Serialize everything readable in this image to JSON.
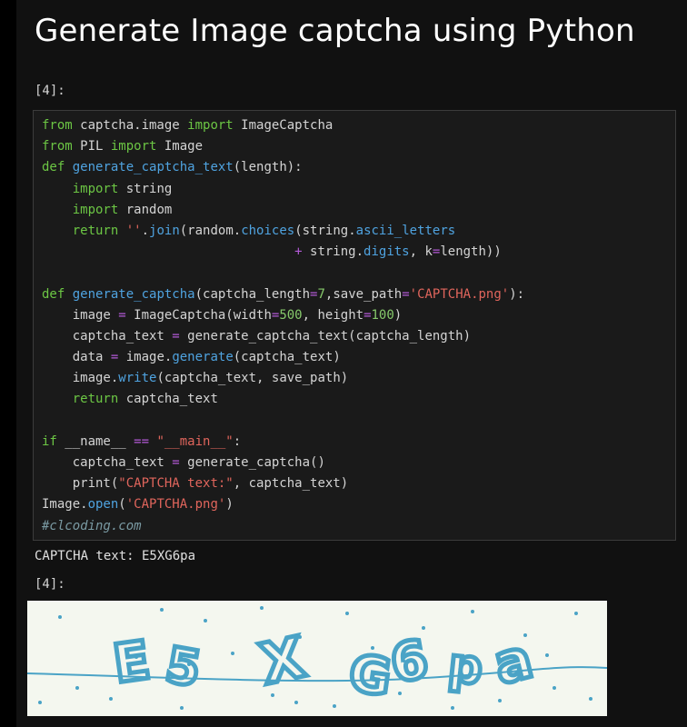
{
  "page": {
    "title": "Generate Image captcha using Python"
  },
  "input_cell": {
    "prompt": "[4]:",
    "lines": [
      [
        {
          "t": "from",
          "c": "kw"
        },
        {
          "t": " captcha.image ",
          "c": "tx"
        },
        {
          "t": "import",
          "c": "kw"
        },
        {
          "t": " ImageCaptcha",
          "c": "tx"
        }
      ],
      [
        {
          "t": "from",
          "c": "kw"
        },
        {
          "t": " PIL ",
          "c": "tx"
        },
        {
          "t": "import",
          "c": "kw"
        },
        {
          "t": " Image",
          "c": "tx"
        }
      ],
      [
        {
          "t": "def",
          "c": "kw"
        },
        {
          "t": " ",
          "c": "tx"
        },
        {
          "t": "generate_captcha_text",
          "c": "fn"
        },
        {
          "t": "(length):",
          "c": "tx"
        }
      ],
      [
        {
          "t": "    ",
          "c": "tx"
        },
        {
          "t": "import",
          "c": "kw"
        },
        {
          "t": " string",
          "c": "tx"
        }
      ],
      [
        {
          "t": "    ",
          "c": "tx"
        },
        {
          "t": "import",
          "c": "kw"
        },
        {
          "t": " random",
          "c": "tx"
        }
      ],
      [
        {
          "t": "    ",
          "c": "tx"
        },
        {
          "t": "return",
          "c": "kw"
        },
        {
          "t": " ",
          "c": "tx"
        },
        {
          "t": "''",
          "c": "str"
        },
        {
          "t": ".",
          "c": "tx"
        },
        {
          "t": "join",
          "c": "fn"
        },
        {
          "t": "(random.",
          "c": "tx"
        },
        {
          "t": "choices",
          "c": "fn"
        },
        {
          "t": "(string.",
          "c": "tx"
        },
        {
          "t": "ascii_letters",
          "c": "fn"
        }
      ],
      [
        {
          "t": "                                 ",
          "c": "tx"
        },
        {
          "t": "+",
          "c": "op"
        },
        {
          "t": " string.",
          "c": "tx"
        },
        {
          "t": "digits",
          "c": "fn"
        },
        {
          "t": ", k",
          "c": "tx"
        },
        {
          "t": "=",
          "c": "op"
        },
        {
          "t": "length))",
          "c": "tx"
        }
      ],
      [],
      [
        {
          "t": "def",
          "c": "kw"
        },
        {
          "t": " ",
          "c": "tx"
        },
        {
          "t": "generate_captcha",
          "c": "fn"
        },
        {
          "t": "(captcha_length",
          "c": "tx"
        },
        {
          "t": "=",
          "c": "op"
        },
        {
          "t": "7",
          "c": "num"
        },
        {
          "t": ",save_path",
          "c": "tx"
        },
        {
          "t": "=",
          "c": "op"
        },
        {
          "t": "'CAPTCHA.png'",
          "c": "str"
        },
        {
          "t": "):",
          "c": "tx"
        }
      ],
      [
        {
          "t": "    image ",
          "c": "tx"
        },
        {
          "t": "=",
          "c": "op"
        },
        {
          "t": " ImageCaptcha(width",
          "c": "tx"
        },
        {
          "t": "=",
          "c": "op"
        },
        {
          "t": "500",
          "c": "num"
        },
        {
          "t": ", height",
          "c": "tx"
        },
        {
          "t": "=",
          "c": "op"
        },
        {
          "t": "100",
          "c": "num"
        },
        {
          "t": ")",
          "c": "tx"
        }
      ],
      [
        {
          "t": "    captcha_text ",
          "c": "tx"
        },
        {
          "t": "=",
          "c": "op"
        },
        {
          "t": " generate_captcha_text(captcha_length)",
          "c": "tx"
        }
      ],
      [
        {
          "t": "    data ",
          "c": "tx"
        },
        {
          "t": "=",
          "c": "op"
        },
        {
          "t": " image.",
          "c": "tx"
        },
        {
          "t": "generate",
          "c": "fn"
        },
        {
          "t": "(captcha_text)",
          "c": "tx"
        }
      ],
      [
        {
          "t": "    image.",
          "c": "tx"
        },
        {
          "t": "write",
          "c": "fn"
        },
        {
          "t": "(captcha_text, save_path)",
          "c": "tx"
        }
      ],
      [
        {
          "t": "    ",
          "c": "tx"
        },
        {
          "t": "return",
          "c": "kw"
        },
        {
          "t": " captcha_text",
          "c": "tx"
        }
      ],
      [],
      [
        {
          "t": "if",
          "c": "kw"
        },
        {
          "t": " __name__ ",
          "c": "tx"
        },
        {
          "t": "==",
          "c": "op"
        },
        {
          "t": " ",
          "c": "tx"
        },
        {
          "t": "\"__main__\"",
          "c": "str"
        },
        {
          "t": ":",
          "c": "tx"
        }
      ],
      [
        {
          "t": "    captcha_text ",
          "c": "tx"
        },
        {
          "t": "=",
          "c": "op"
        },
        {
          "t": " generate_captcha()",
          "c": "tx"
        }
      ],
      [
        {
          "t": "    print(",
          "c": "tx"
        },
        {
          "t": "\"CAPTCHA text:\"",
          "c": "str"
        },
        {
          "t": ", captcha_text)",
          "c": "tx"
        }
      ],
      [
        {
          "t": "Image.",
          "c": "tx"
        },
        {
          "t": "open",
          "c": "fn"
        },
        {
          "t": "(",
          "c": "tx"
        },
        {
          "t": "'CAPTCHA.png'",
          "c": "str"
        },
        {
          "t": ")",
          "c": "tx"
        }
      ],
      [
        {
          "t": "#clcoding.com",
          "c": "cm"
        }
      ]
    ]
  },
  "output": {
    "stdout": "CAPTCHA text: E5XG6pa",
    "prompt": "[4]:",
    "image": {
      "text": "E5XG6pa",
      "background": "#f4f7ef",
      "ink": "#4aa3c6"
    }
  },
  "colors": {
    "kw": "#6cc644",
    "fn": "#4fa3e0",
    "str": "#e0655c",
    "num": "#86c96b",
    "op": "#b45ad8",
    "cm": "#7a9aa3",
    "tx": "#d4d4d4"
  }
}
